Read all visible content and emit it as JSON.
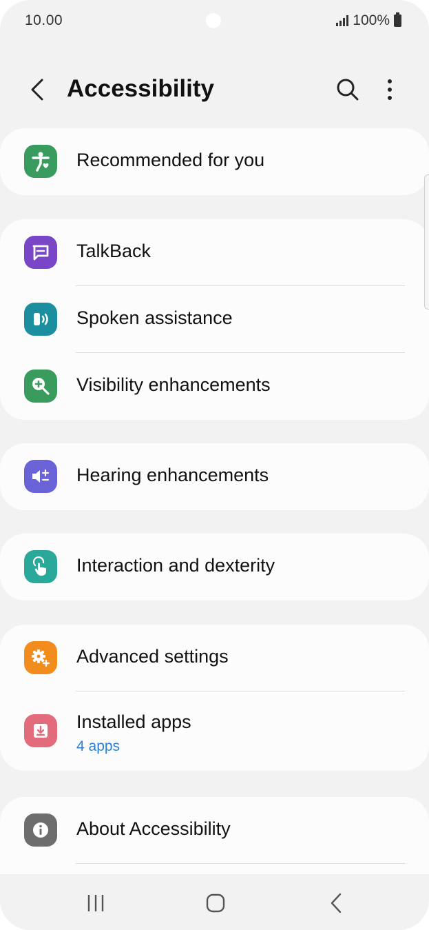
{
  "status_bar": {
    "time": "10.00",
    "battery_text": "100%"
  },
  "app_bar": {
    "title": "Accessibility",
    "icons": [
      "back-arrow-icon",
      "search-icon",
      "more-options-icon"
    ]
  },
  "groups": [
    {
      "items": [
        {
          "label": "Recommended for you",
          "icon": "accessibility-person-icon",
          "color": "#3a9b5e"
        }
      ]
    },
    {
      "items": [
        {
          "label": "TalkBack",
          "icon": "talkback-icon",
          "color": "#7a46c8"
        },
        {
          "label": "Spoken assistance",
          "icon": "spoken-assistance-icon",
          "color": "#1b8fa0"
        },
        {
          "label": "Visibility enhancements",
          "icon": "magnifier-plus-icon",
          "color": "#3a9b5e"
        }
      ]
    },
    {
      "items": [
        {
          "label": "Hearing enhancements",
          "icon": "hearing-icon",
          "color": "#6a63d8"
        }
      ]
    },
    {
      "items": [
        {
          "label": "Interaction and dexterity",
          "icon": "touch-hand-icon",
          "color": "#2aa89a"
        }
      ]
    },
    {
      "items": [
        {
          "label": "Advanced settings",
          "icon": "gear-plus-icon",
          "color": "#f28c1c"
        },
        {
          "label": "Installed apps",
          "sublabel": "4 apps",
          "icon": "download-icon",
          "color": "#e26b7c"
        }
      ]
    },
    {
      "items": [
        {
          "label": "About Accessibility",
          "icon": "info-icon",
          "color": "#6d6d6d"
        }
      ]
    }
  ],
  "navigation_bar": {
    "icons": [
      "recent-apps-icon",
      "home-icon",
      "back-icon"
    ]
  }
}
